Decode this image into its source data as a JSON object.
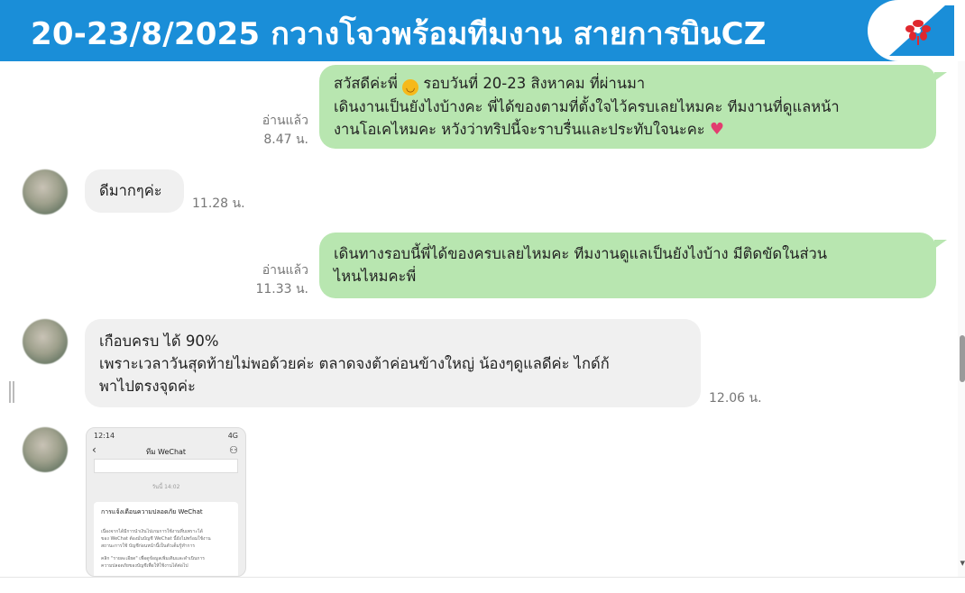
{
  "header": {
    "title": "20-23/8/2025 กวางโจวพร้อมทีมงาน สายการบินCZ",
    "logo": "china-southern-logo",
    "bg_color": "#1a8ed8"
  },
  "messages": [
    {
      "side": "me",
      "lines": [
        "สวัสดีค่ะพี่ ",
        " รอบวันที่ 20-23 สิงหาคม ที่ผ่านมา",
        "เดินงานเป็นยังไงบ้างคะ พี่ได้ของตามที่ตั้งใจไว้ครบเลยไหมคะ ทีมงานที่ดูแลหน้า",
        "งานโอเคไหมคะ หวังว่าทริปนี้จะราบรื่นและประทับใจนะคะ "
      ],
      "read_label": "อ่านแล้ว",
      "time": "8.47 น."
    },
    {
      "side": "them",
      "lines": [
        "ดีมากๆค่ะ"
      ],
      "time": "11.28 น."
    },
    {
      "side": "me",
      "lines": [
        "เดินทางรอบนี้พี่ได้ของครบเลยไหมคะ ทีมงานดูแลเป็นยังไงบ้าง มีติดขัดในส่วน",
        "ไหนไหมคะพี่"
      ],
      "read_label": "อ่านแล้ว",
      "time": "11.33 น."
    },
    {
      "side": "them",
      "lines": [
        "เกือบครบ ได้ 90%",
        "เพราะเวลาวันสุดท้ายไม่พอด้วยค่ะ ตลาดจงต้าค่อนข้างใหญ่ น้องๆดูแลดีค่ะ ไกด์ก้",
        "พาไปตรงจุดค่ะ"
      ],
      "time": "12.06 น."
    }
  ],
  "screenshot": {
    "status_left": "12:14",
    "status_right": "4G",
    "title": "ทีม WeChat",
    "time": "วันนี้ 14:02",
    "card_title": "การแจ้งเตือนความปลอดภัย WeChat",
    "card_lines": [
      "เนื่องจากได้มีการนำเงินไปเกมการใช้งานที่บเพราะได้",
      "ของ WeChat ต้องมั่นบัญชี WeChat นี้ยังไม่พร้อมใช้งาน",
      "สถานะการใช้ บัญชีก่อนหน้านี้เป็นตัวเต็มรู้ทำการ",
      "คลิก \"รายละเอียด\" เพื่อดูข้อมูลเพิ่มเติมและดำเนินการ",
      "ความปลอดภัยของบัญชีเพื่อให้ใช้งานได้ต่อไป"
    ]
  }
}
